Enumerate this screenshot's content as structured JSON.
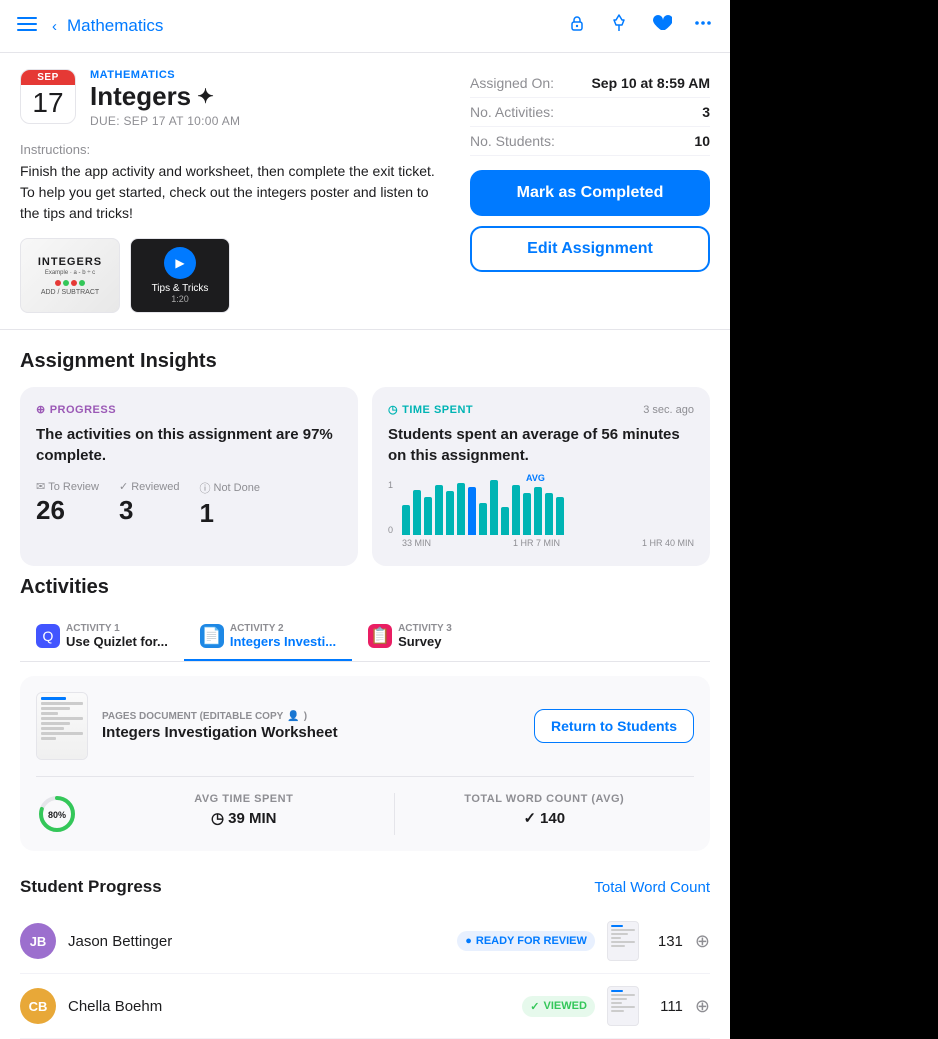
{
  "nav": {
    "back_label": "Mathematics",
    "icons": [
      "sidebar",
      "back",
      "lock",
      "pin",
      "heart",
      "more"
    ]
  },
  "header": {
    "calendar": {
      "month": "SEP",
      "day": "17"
    },
    "subject": "MATHEMATICS",
    "title": "Integers",
    "sparkle": "✦",
    "due": "DUE: SEP 17 AT 10:00 AM",
    "instructions_label": "Instructions:",
    "instructions_text": "Finish the app activity and worksheet, then complete the exit ticket. To help you get started, check out the integers poster and listen to the tips and tricks!",
    "attachments": [
      {
        "type": "poster",
        "label": "INTEGERS",
        "sub": "Example"
      },
      {
        "type": "video",
        "label": "Tips & Tricks",
        "duration": "1:20"
      }
    ]
  },
  "info": {
    "assigned_on_label": "Assigned On:",
    "assigned_on_value": "Sep 10 at 8:59 AM",
    "activities_label": "No. Activities:",
    "activities_value": "3",
    "students_label": "No. Students:",
    "students_value": "10",
    "btn_complete": "Mark as Completed",
    "btn_edit": "Edit Assignment"
  },
  "insights": {
    "section_title": "Assignment Insights",
    "progress_card": {
      "label": "PROGRESS",
      "icon": "⊕",
      "text": "The activities on this assignment are 97% complete.",
      "stats": [
        {
          "icon": "✉",
          "label": "To Review",
          "value": "26"
        },
        {
          "icon": "✓",
          "label": "Reviewed",
          "value": "3"
        },
        {
          "icon": "!",
          "label": "Not Done",
          "value": "1"
        }
      ]
    },
    "time_card": {
      "label": "TIME SPENT",
      "icon": "◷",
      "timestamp": "3 sec. ago",
      "text": "Students spent an average of 56 minutes on this assignment.",
      "chart": {
        "bars": [
          30,
          45,
          40,
          55,
          50,
          60,
          56,
          48,
          70,
          42,
          65,
          50,
          55,
          60,
          58
        ],
        "y_labels": [
          "1",
          "0"
        ],
        "x_labels": [
          "33 MIN",
          "1 HR 7 MIN",
          "1 HR 40 MIN"
        ],
        "avg_label": "AVG"
      }
    }
  },
  "activities": {
    "section_title": "Activities",
    "tabs": [
      {
        "number": "ACTIVITY 1",
        "name": "Use Quizlet for...",
        "icon_type": "quizlet",
        "icon": "Q"
      },
      {
        "number": "ACTIVITY 2",
        "name": "Integers Investi...",
        "icon_type": "doc",
        "icon": "📄",
        "active": true
      },
      {
        "number": "ACTIVITY 3",
        "name": "Survey",
        "icon_type": "survey",
        "icon": "📋"
      }
    ],
    "active_content": {
      "doc_type": "PAGES DOCUMENT (EDITABLE COPY",
      "doc_name": "Integers Investigation Worksheet",
      "btn_return": "Return to Students",
      "stats": [
        {
          "label": "AVG TIME SPENT",
          "icon": "◷",
          "value": "39 MIN"
        },
        {
          "label": "TOTAL WORD COUNT (AVG)",
          "icon": "✓",
          "value": "140"
        }
      ],
      "progress_pct": 80
    }
  },
  "student_progress": {
    "title": "Student Progress",
    "word_count_link": "Total Word Count",
    "students": [
      {
        "initials": "JB",
        "name": "Jason Bettinger",
        "status": "READY FOR REVIEW",
        "status_type": "review",
        "word_count": "131",
        "avatar_color": "#9c6fce"
      },
      {
        "initials": "CB",
        "name": "Chella Boehm",
        "status": "VIEWED",
        "status_type": "viewed",
        "word_count": "111",
        "avatar_color": "#E8A838"
      }
    ]
  }
}
